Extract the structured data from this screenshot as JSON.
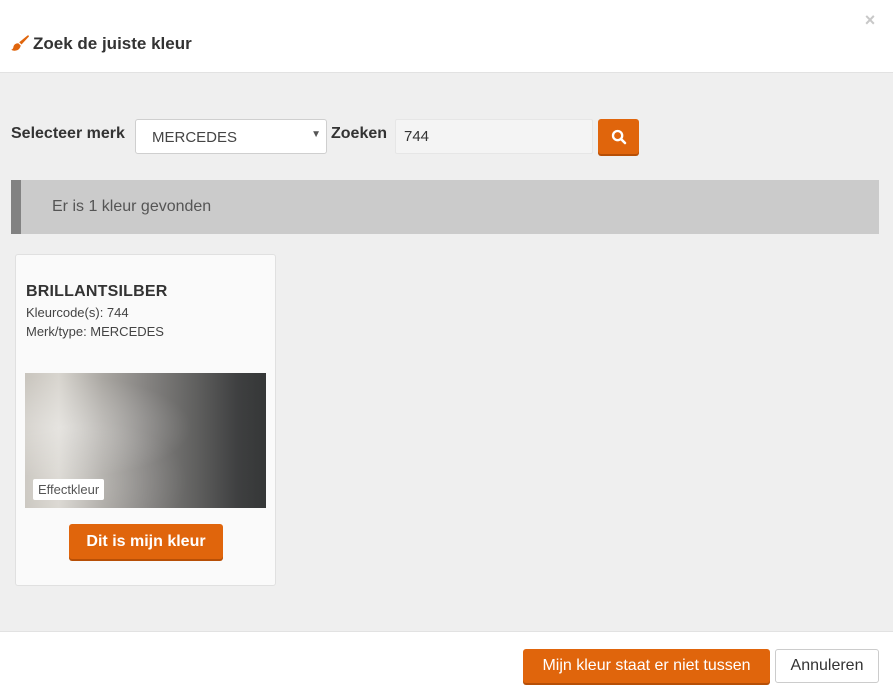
{
  "dialog": {
    "title": "Zoek de juiste kleur",
    "title_icon": "paint-brush-icon",
    "close_label": "×",
    "close_icon": "close-icon"
  },
  "search": {
    "brand_label": "Selecteer merk",
    "brand_selected": "MERCEDES",
    "search_label": "Zoeken",
    "search_value": "744",
    "search_button_icon": "search-icon"
  },
  "results": {
    "summary": "Er is 1 kleur gevonden",
    "items": [
      {
        "name": "BRILLANTSILBER",
        "codes": "Kleurcode(s): 744",
        "brand": "Merk/type: MERCEDES",
        "badge": "Effectkleur",
        "select_label": "Dit is mijn kleur"
      }
    ]
  },
  "footer": {
    "not_listed_label": "Mijn kleur staat er niet tussen",
    "cancel_label": "Annuleren"
  },
  "colors": {
    "accent": "#e0650c",
    "body_bg": "#efefef",
    "result_bar": "#cbcbcb",
    "result_bar_edge": "#828282"
  }
}
